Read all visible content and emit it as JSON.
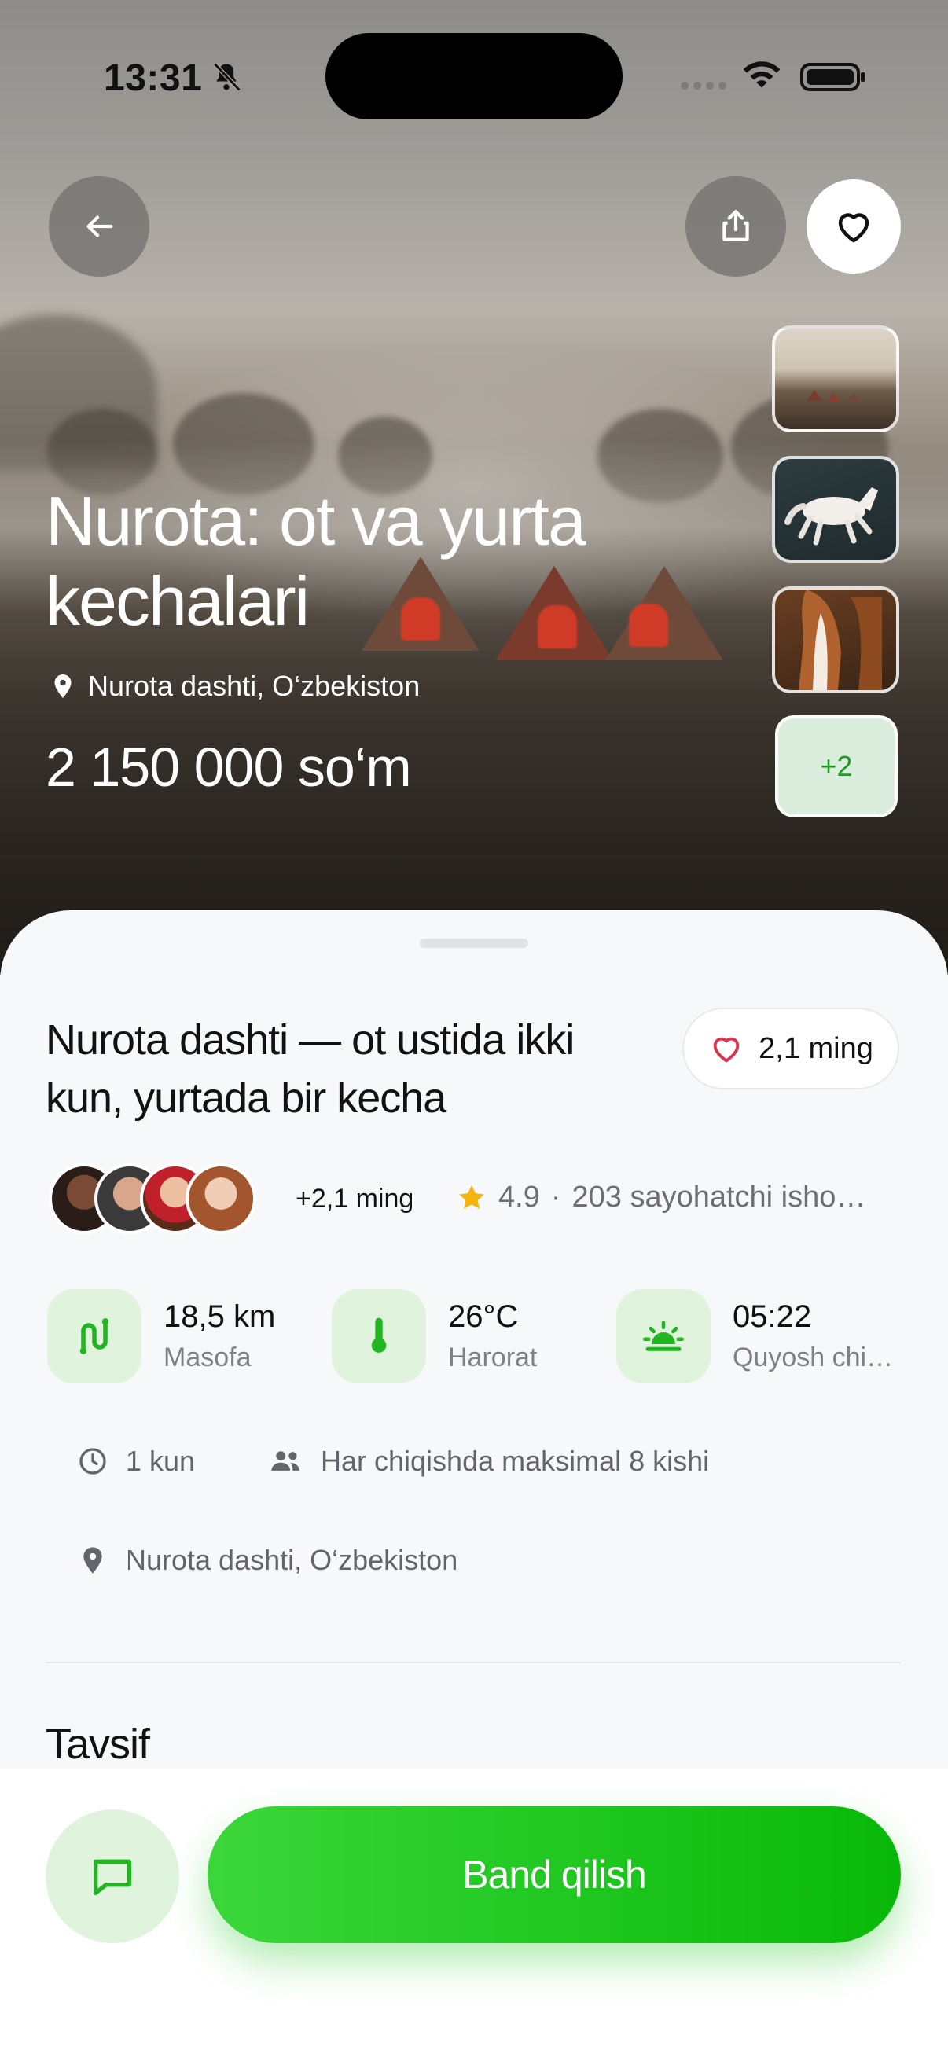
{
  "status_bar": {
    "time": "13:31"
  },
  "hero": {
    "title": "Nurota: ot va yurta kechalari",
    "location": "Nurota dashti, O‘zbekiston",
    "price": "2 150 000 so‘m",
    "more_photos": "+2"
  },
  "details": {
    "title": "Nurota dashti — ot ustida ikki kun, yurtada bir kecha",
    "likes": "2,1 ming",
    "participants_more": "+2,1 ming",
    "rating": "4.9",
    "rating_separator": "·",
    "reviews": "203 sayohatchi isho…",
    "stats": [
      {
        "value": "18,5 km",
        "label": "Masofa",
        "icon": "route-icon"
      },
      {
        "value": "26°C",
        "label": "Harorat",
        "icon": "thermometer-icon"
      },
      {
        "value": "05:22",
        "label": "Quyosh chi…",
        "icon": "sunrise-icon"
      }
    ],
    "duration": "1 kun",
    "group_size": "Har chiqishda maksimal 8 kishi",
    "location": "Nurota dashti, O‘zbekiston",
    "section_title": "Tavsif"
  },
  "actions": {
    "book_label": "Band qilish"
  },
  "colors": {
    "accent": "#1fc71f",
    "accent_soft": "#e0f4dd",
    "heart": "#e0314f",
    "star": "#f5b40b"
  }
}
